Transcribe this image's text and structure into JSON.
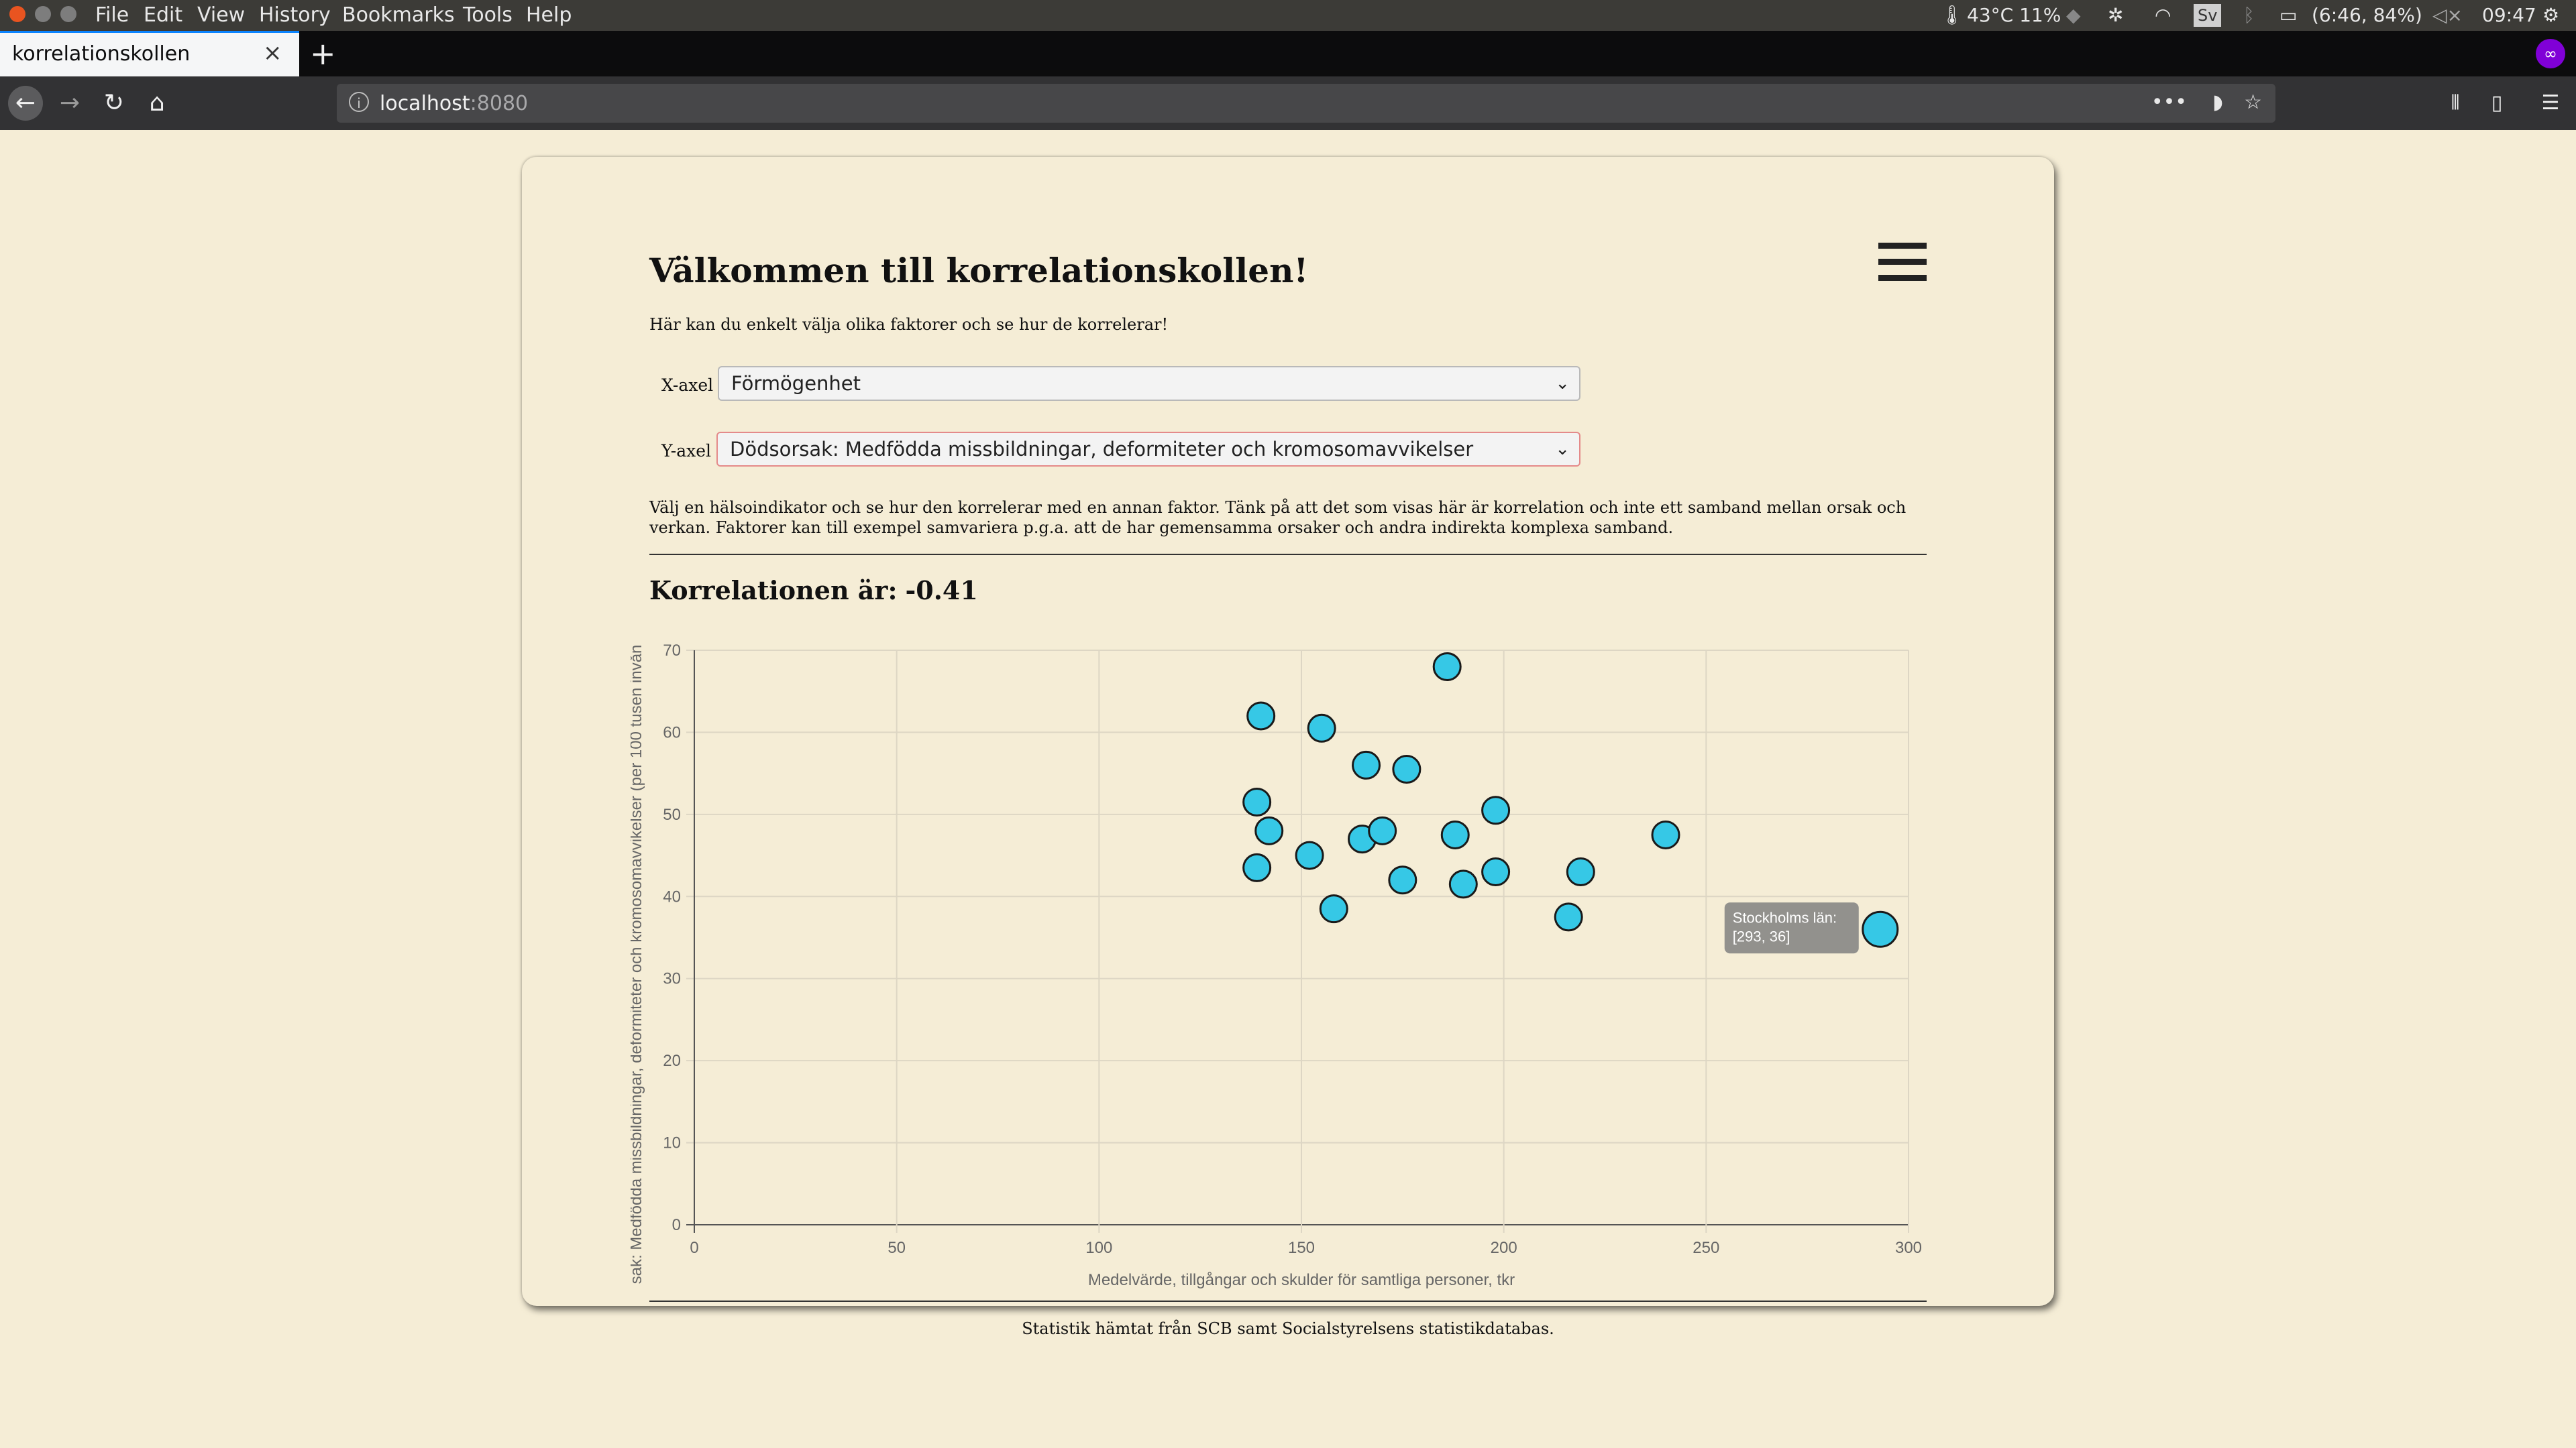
{
  "os": {
    "menu": [
      "File",
      "Edit",
      "View",
      "History",
      "Bookmarks",
      "Tools",
      "Help"
    ],
    "temp": "43°C 11%",
    "keyboard": "Sv",
    "battery": "(6:46, 84%)",
    "clock": "09:47"
  },
  "browser": {
    "tab_title": "korrelationskollen",
    "url_host": "localhost",
    "url_port": ":8080"
  },
  "page": {
    "title": "Välkommen till korrelationskollen!",
    "intro": "Här kan du enkelt välja olika faktorer och se hur de korrelerar!",
    "x_label": "X-axel",
    "x_value": "Förmögenhet",
    "y_label": "Y-axel",
    "y_value": "Dödsorsak: Medfödda missbildningar, deformiteter och kromosomavvikelser",
    "description": "Välj en hälsoindikator och se hur den korrelerar med en annan faktor. Tänk på att det som visas här är korrelation och inte ett samband mellan orsak och verkan. Faktorer kan till exempel samvariera p.g.a. att de har gemensamma orsaker och andra indirekta komplexa samband.",
    "corr_label": "Korrelationen är:",
    "corr_value": "-0.41",
    "footer": "Statistik hämtat från SCB samt Socialstyrelsens statistikdatabas."
  },
  "chart_data": {
    "type": "scatter",
    "xlabel": "Medelvärde, tillgångar och skulder för samtliga personer, tkr",
    "ylabel": "sak: Medfödda missbildningar, deformiteter och kromosomavvikelser (per 100 tusen invån",
    "xlim": [
      0,
      300
    ],
    "ylim": [
      0,
      70
    ],
    "xticks": [
      0,
      50,
      100,
      150,
      200,
      250,
      300
    ],
    "yticks": [
      0,
      10,
      20,
      30,
      40,
      50,
      60,
      70
    ],
    "grid": true,
    "point_color": "#36c8e6",
    "points": [
      {
        "x": 186,
        "y": 68
      },
      {
        "x": 140,
        "y": 62
      },
      {
        "x": 155,
        "y": 60.5
      },
      {
        "x": 166,
        "y": 56
      },
      {
        "x": 176,
        "y": 55.5
      },
      {
        "x": 139,
        "y": 51.5
      },
      {
        "x": 142,
        "y": 48
      },
      {
        "x": 152,
        "y": 45
      },
      {
        "x": 165,
        "y": 47
      },
      {
        "x": 170,
        "y": 48
      },
      {
        "x": 188,
        "y": 47.5
      },
      {
        "x": 198,
        "y": 50.5
      },
      {
        "x": 240,
        "y": 47.5
      },
      {
        "x": 139,
        "y": 43.5
      },
      {
        "x": 175,
        "y": 42
      },
      {
        "x": 190,
        "y": 41.5
      },
      {
        "x": 198,
        "y": 43
      },
      {
        "x": 219,
        "y": 43
      },
      {
        "x": 158,
        "y": 38.5
      },
      {
        "x": 216,
        "y": 37.5
      },
      {
        "x": 293,
        "y": 36
      }
    ],
    "tooltip": {
      "title": "Stockholms län:",
      "value": "[293, 36]"
    }
  }
}
